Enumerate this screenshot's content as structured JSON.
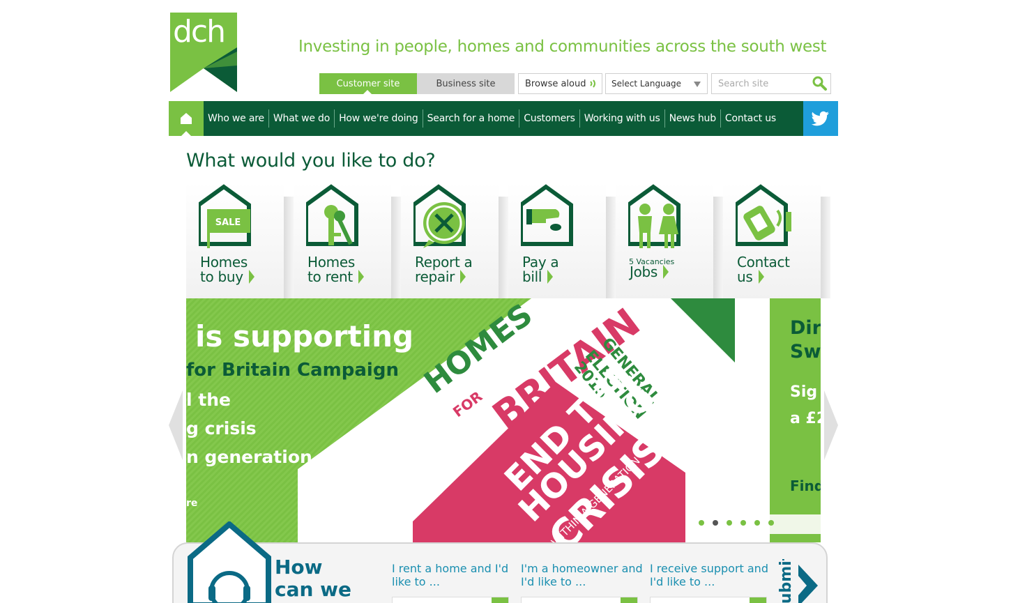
{
  "header": {
    "logo_text": "dch",
    "tagline": "Investing in people, homes and communities across the south west"
  },
  "utility": {
    "site_tabs": [
      "Customer site",
      "Business site"
    ],
    "browse_aloud": "Browse aloud",
    "language": "Select Language",
    "search_placeholder": "Search site"
  },
  "nav": {
    "items": [
      "Who we are",
      "What we do",
      "How we're doing",
      "Search for a home",
      "Customers",
      "Working with us",
      "News hub",
      "Contact us"
    ]
  },
  "main": {
    "heading": "What would you like to do?",
    "tiles": [
      {
        "line1": "Homes",
        "line2": "to buy",
        "icon": "house-sale-sign-icon"
      },
      {
        "line1": "Homes",
        "line2": "to rent",
        "icon": "house-keys-icon"
      },
      {
        "line1": "Report a",
        "line2": "repair",
        "icon": "house-tools-icon"
      },
      {
        "line1": "Pay a",
        "line2": "bill",
        "icon": "house-hand-coin-icon"
      },
      {
        "line1": "",
        "line2": "Jobs",
        "icon": "house-people-icon",
        "note": "5 Vacancies"
      },
      {
        "line1": "Contact",
        "line2": "us",
        "icon": "house-phone-icon"
      }
    ]
  },
  "carousel": {
    "slide1": {
      "line1": "is supporting",
      "line2": "for Britain Campaign",
      "line3": "l the",
      "line4": "g crisis",
      "line5": "n generation",
      "line6": "re",
      "poster_homes": "HOMES",
      "poster_for": "FOR",
      "poster_britain": "BRITAIN",
      "poster_election": "GENERAL",
      "poster_election2": "ELECTION",
      "poster_year": "2015",
      "poster_end": "END THE",
      "poster_housing": "HOUSING",
      "poster_crisis": "CRISIS",
      "poster_within": "WITHIN A GENERATION"
    },
    "slide2": {
      "line1": "Dir",
      "line2": "Sw",
      "line3": "Sig",
      "line4": "a £2",
      "line5": "Find"
    },
    "dot_count": 6,
    "active_dot": 1
  },
  "help": {
    "title_line1": "How",
    "title_line2": "can we",
    "col1": "I rent a home and I'd like to ...",
    "col2": "I'm a homeowner and I'd like to ...",
    "col3": "I receive support and I'd like to ...",
    "submit": "Submit"
  },
  "colors": {
    "brand_green": "#7ac143",
    "dark_green": "#0b5b37",
    "twitter_blue": "#1f9edb",
    "poster_pink": "#d83a66"
  }
}
